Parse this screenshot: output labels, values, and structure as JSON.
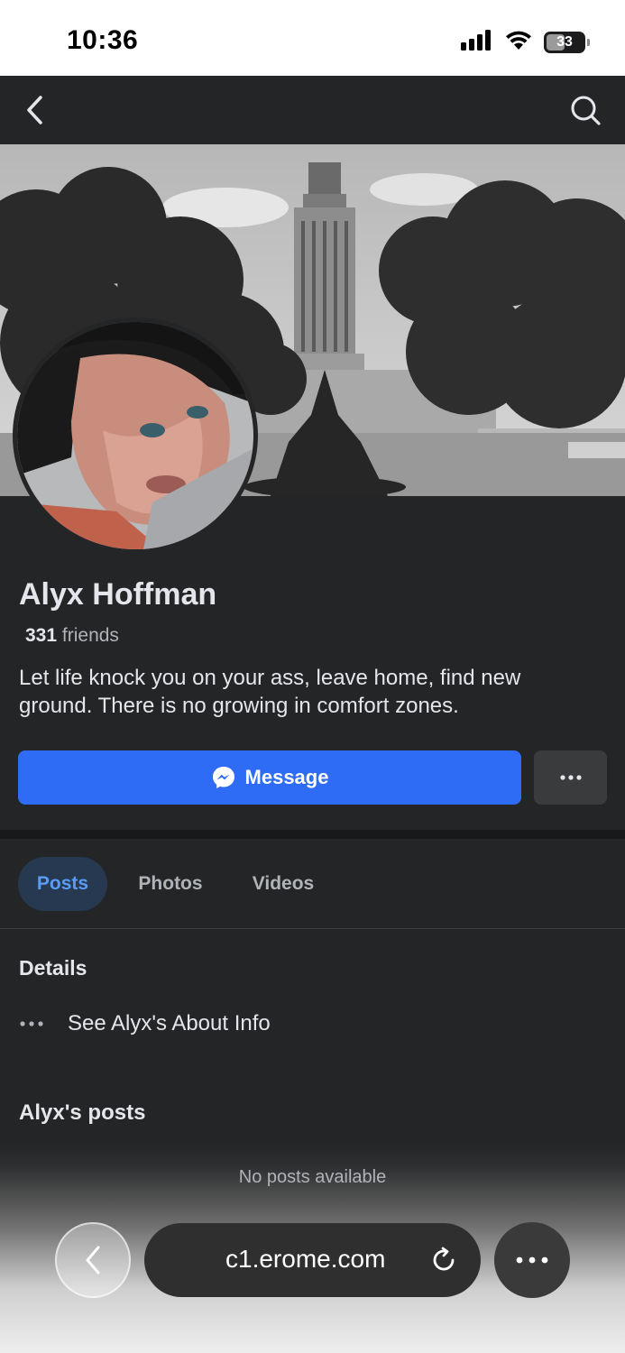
{
  "status_bar": {
    "time": "10:36",
    "battery": "33"
  },
  "profile": {
    "name": "Alyx Hoffman",
    "friends_count": "331",
    "friends_label": "friends",
    "bio": "Let life knock you on your ass, leave home, find new ground. There is no growing in comfort zones."
  },
  "actions": {
    "message_label": "Message"
  },
  "tabs": [
    {
      "label": "Posts",
      "active": true
    },
    {
      "label": "Photos",
      "active": false
    },
    {
      "label": "Videos",
      "active": false
    }
  ],
  "details": {
    "title": "Details",
    "about_link": "See Alyx's About Info"
  },
  "posts": {
    "title": "Alyx's posts",
    "empty_text": "No posts available"
  },
  "browser": {
    "url": "c1.erome.com"
  },
  "colors": {
    "accent": "#2e6cf6",
    "background": "#242526",
    "active_tab_text": "#5a9cf5"
  },
  "icons": [
    "chevron-left-icon",
    "search-icon",
    "messenger-icon",
    "more-dots-icon",
    "reload-icon",
    "cellular-signal-icon",
    "wifi-icon",
    "battery-icon"
  ]
}
